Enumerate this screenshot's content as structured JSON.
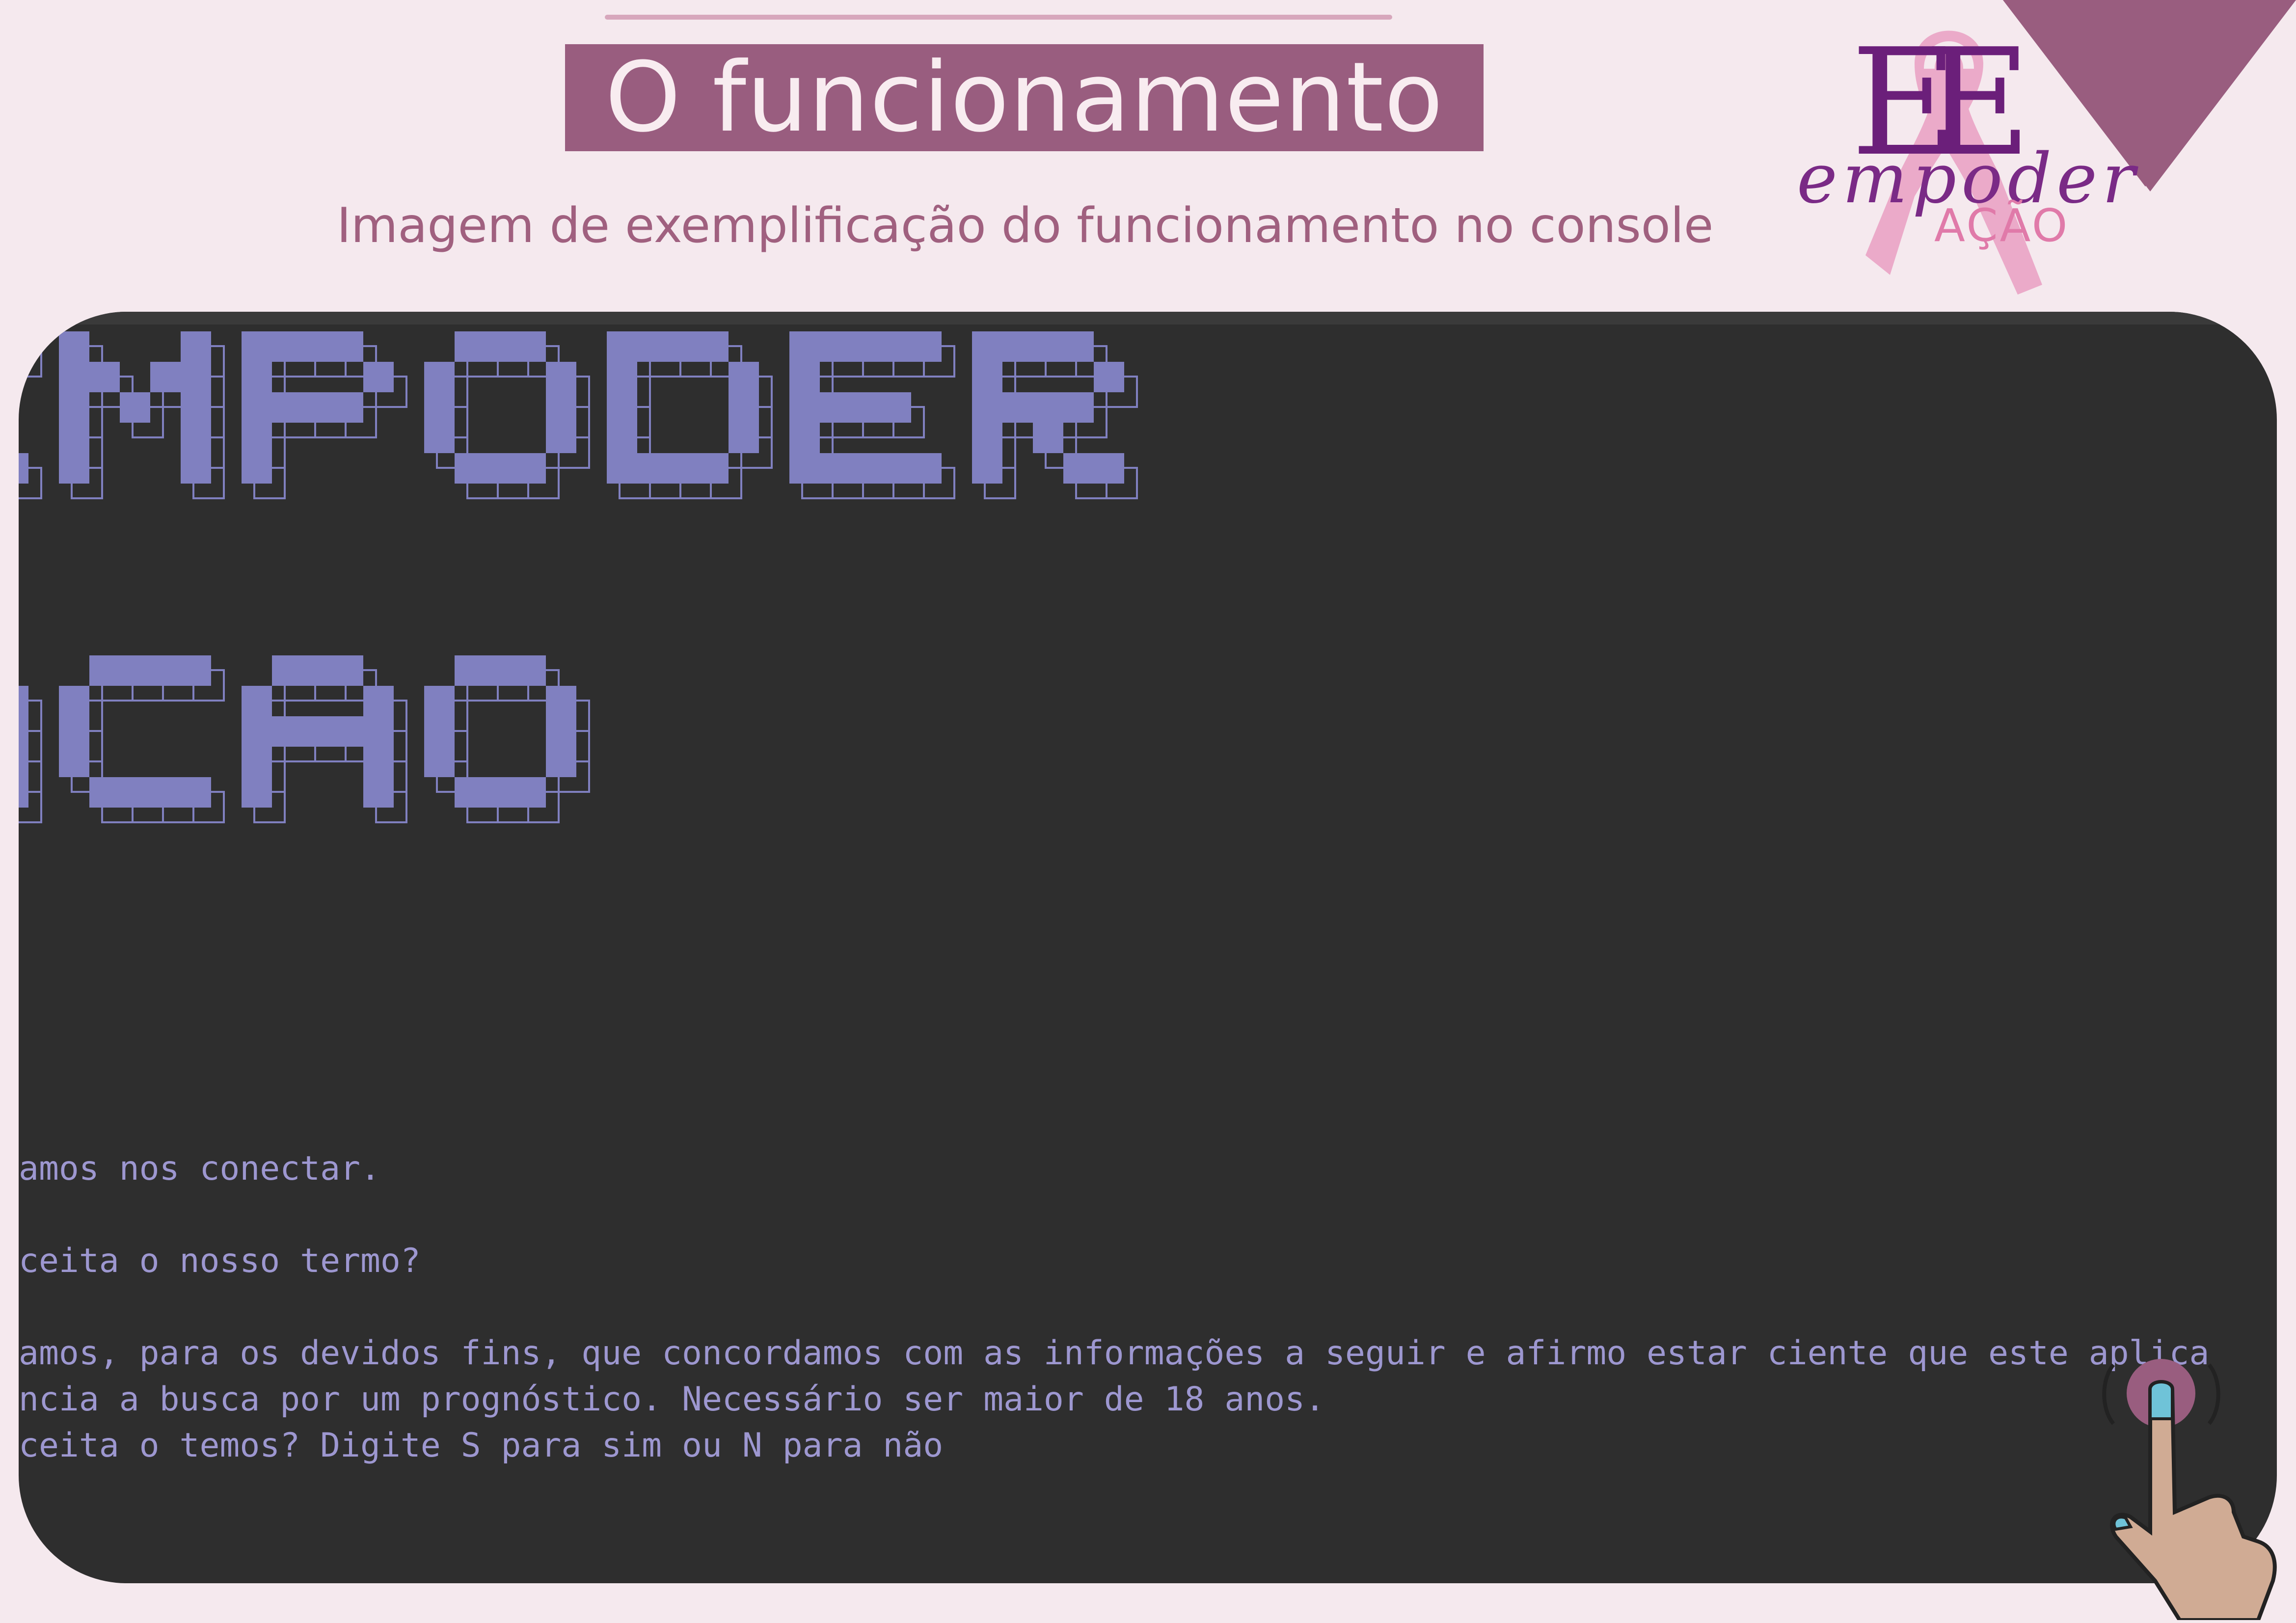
{
  "header": {
    "title": "O funcionamento",
    "subtitle": "Imagem de exemplificação do funcionamento no console"
  },
  "logo": {
    "monogram": "EE",
    "wordmark": "empoder",
    "suffix": "AÇÃO",
    "icon": "pink-ribbon-icon"
  },
  "console": {
    "banner_lines": [
      "EMPODER",
      "ACAO"
    ],
    "lines": [
      "amos nos conectar.",
      "",
      "ceita o nosso termo?",
      "",
      "amos, para os devidos fins, que concordamos com as informações a seguir e afirmo estar ciente que este aplica",
      "ncia a busca por um prognóstico. Necessário ser maior de 18 anos.",
      "ceita o temos? Digite S para sim ou N para não"
    ]
  },
  "decor": {
    "hand_icon": "tap-hand-icon"
  },
  "colors": {
    "background": "#f5e9ee",
    "accent": "#995d7f",
    "console_bg": "#2e2e2e",
    "banner": "#8080c0",
    "console_text": "#9d97d0",
    "ribbon": "#eaa3c4",
    "logo_purple": "#6b1f7a"
  }
}
